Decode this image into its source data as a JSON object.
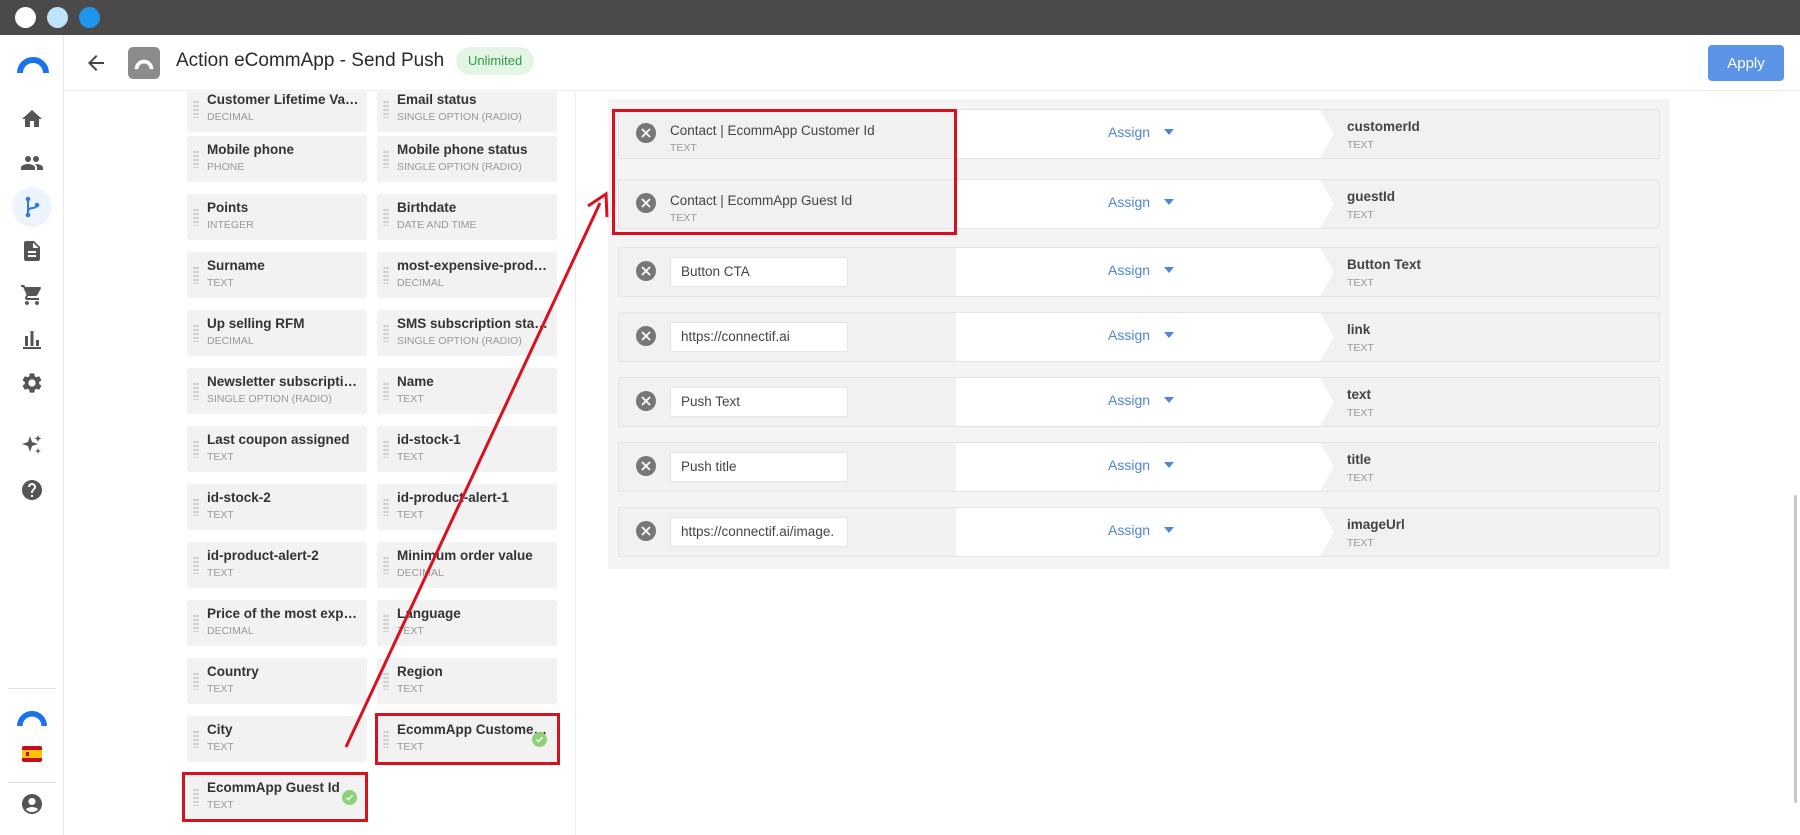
{
  "window": {
    "controls": [
      "close-icon",
      "minimize-icon",
      "maximize-icon"
    ]
  },
  "sidebar": {
    "items": [
      {
        "name": "home",
        "icon": "home-icon"
      },
      {
        "name": "contacts",
        "icon": "people-icon"
      },
      {
        "name": "workflows",
        "icon": "workflow-icon",
        "active": true
      },
      {
        "name": "content",
        "icon": "document-icon"
      },
      {
        "name": "store",
        "icon": "cart-icon"
      },
      {
        "name": "reports",
        "icon": "bar-chart-icon"
      },
      {
        "name": "settings",
        "icon": "gear-icon"
      },
      {
        "name": "ai",
        "icon": "sparkles-icon"
      },
      {
        "name": "help",
        "icon": "help-icon"
      }
    ],
    "bottom": [
      {
        "name": "brand",
        "icon": "connectif-logo-icon"
      },
      {
        "name": "language",
        "icon": "spain-flag-icon"
      },
      {
        "name": "account",
        "icon": "user-icon"
      }
    ]
  },
  "header": {
    "title": "Action eCommApp - Send Push",
    "badge": "Unlimited",
    "apply_label": "Apply",
    "brand_color": "#1a73e8",
    "apply_color": "#5b93e6"
  },
  "fields": [
    {
      "name": "Customer Lifetime Val...",
      "type": "DECIMAL"
    },
    {
      "name": "Email status",
      "type": "SINGLE OPTION (RADIO)"
    },
    {
      "name": "Mobile phone",
      "type": "PHONE"
    },
    {
      "name": "Mobile phone status",
      "type": "SINGLE OPTION (RADIO)"
    },
    {
      "name": "Points",
      "type": "INTEGER"
    },
    {
      "name": "Birthdate",
      "type": "DATE AND TIME"
    },
    {
      "name": "Surname",
      "type": "TEXT"
    },
    {
      "name": "most-expensive-produ...",
      "type": "DECIMAL"
    },
    {
      "name": "Up selling RFM",
      "type": "DECIMAL"
    },
    {
      "name": "SMS subscription status",
      "type": "SINGLE OPTION (RADIO)"
    },
    {
      "name": "Newsletter subscriptio...",
      "type": "SINGLE OPTION (RADIO)"
    },
    {
      "name": "Name",
      "type": "TEXT"
    },
    {
      "name": "Last coupon assigned",
      "type": "TEXT"
    },
    {
      "name": "id-stock-1",
      "type": "TEXT"
    },
    {
      "name": "id-stock-2",
      "type": "TEXT"
    },
    {
      "name": "id-product-alert-1",
      "type": "TEXT"
    },
    {
      "name": "id-product-alert-2",
      "type": "TEXT"
    },
    {
      "name": "Minimum order value",
      "type": "DECIMAL"
    },
    {
      "name": "Price of the most expe...",
      "type": "DECIMAL"
    },
    {
      "name": "Language",
      "type": "TEXT"
    },
    {
      "name": "Country",
      "type": "TEXT"
    },
    {
      "name": "Region",
      "type": "TEXT"
    },
    {
      "name": "City",
      "type": "TEXT"
    },
    {
      "name": "EcommApp Customer Id",
      "type": "TEXT",
      "assigned": true
    },
    {
      "name": "EcommApp Guest Id",
      "type": "TEXT",
      "assigned": true
    }
  ],
  "mappings": [
    {
      "source": "Contact | EcommApp Customer Id",
      "source_type": "TEXT",
      "assign": "Assign",
      "target": "customerId",
      "target_type": "TEXT"
    },
    {
      "source": "Contact | EcommApp Guest Id",
      "source_type": "TEXT",
      "assign": "Assign",
      "target": "guestId",
      "target_type": "TEXT"
    },
    {
      "source_value": "Button CTA",
      "assign": "Assign",
      "target": "Button Text",
      "target_type": "TEXT"
    },
    {
      "source_value": "https://connectif.ai",
      "assign": "Assign",
      "target": "link",
      "target_type": "TEXT"
    },
    {
      "source_value": "Push Text",
      "assign": "Assign",
      "target": "text",
      "target_type": "TEXT"
    },
    {
      "source_value": "Push title",
      "assign": "Assign",
      "target": "title",
      "target_type": "TEXT"
    },
    {
      "source_value": "https://connectif.ai/image.",
      "assign": "Assign",
      "target": "imageUrl",
      "target_type": "TEXT"
    }
  ],
  "annotation_color": "#d9101f"
}
